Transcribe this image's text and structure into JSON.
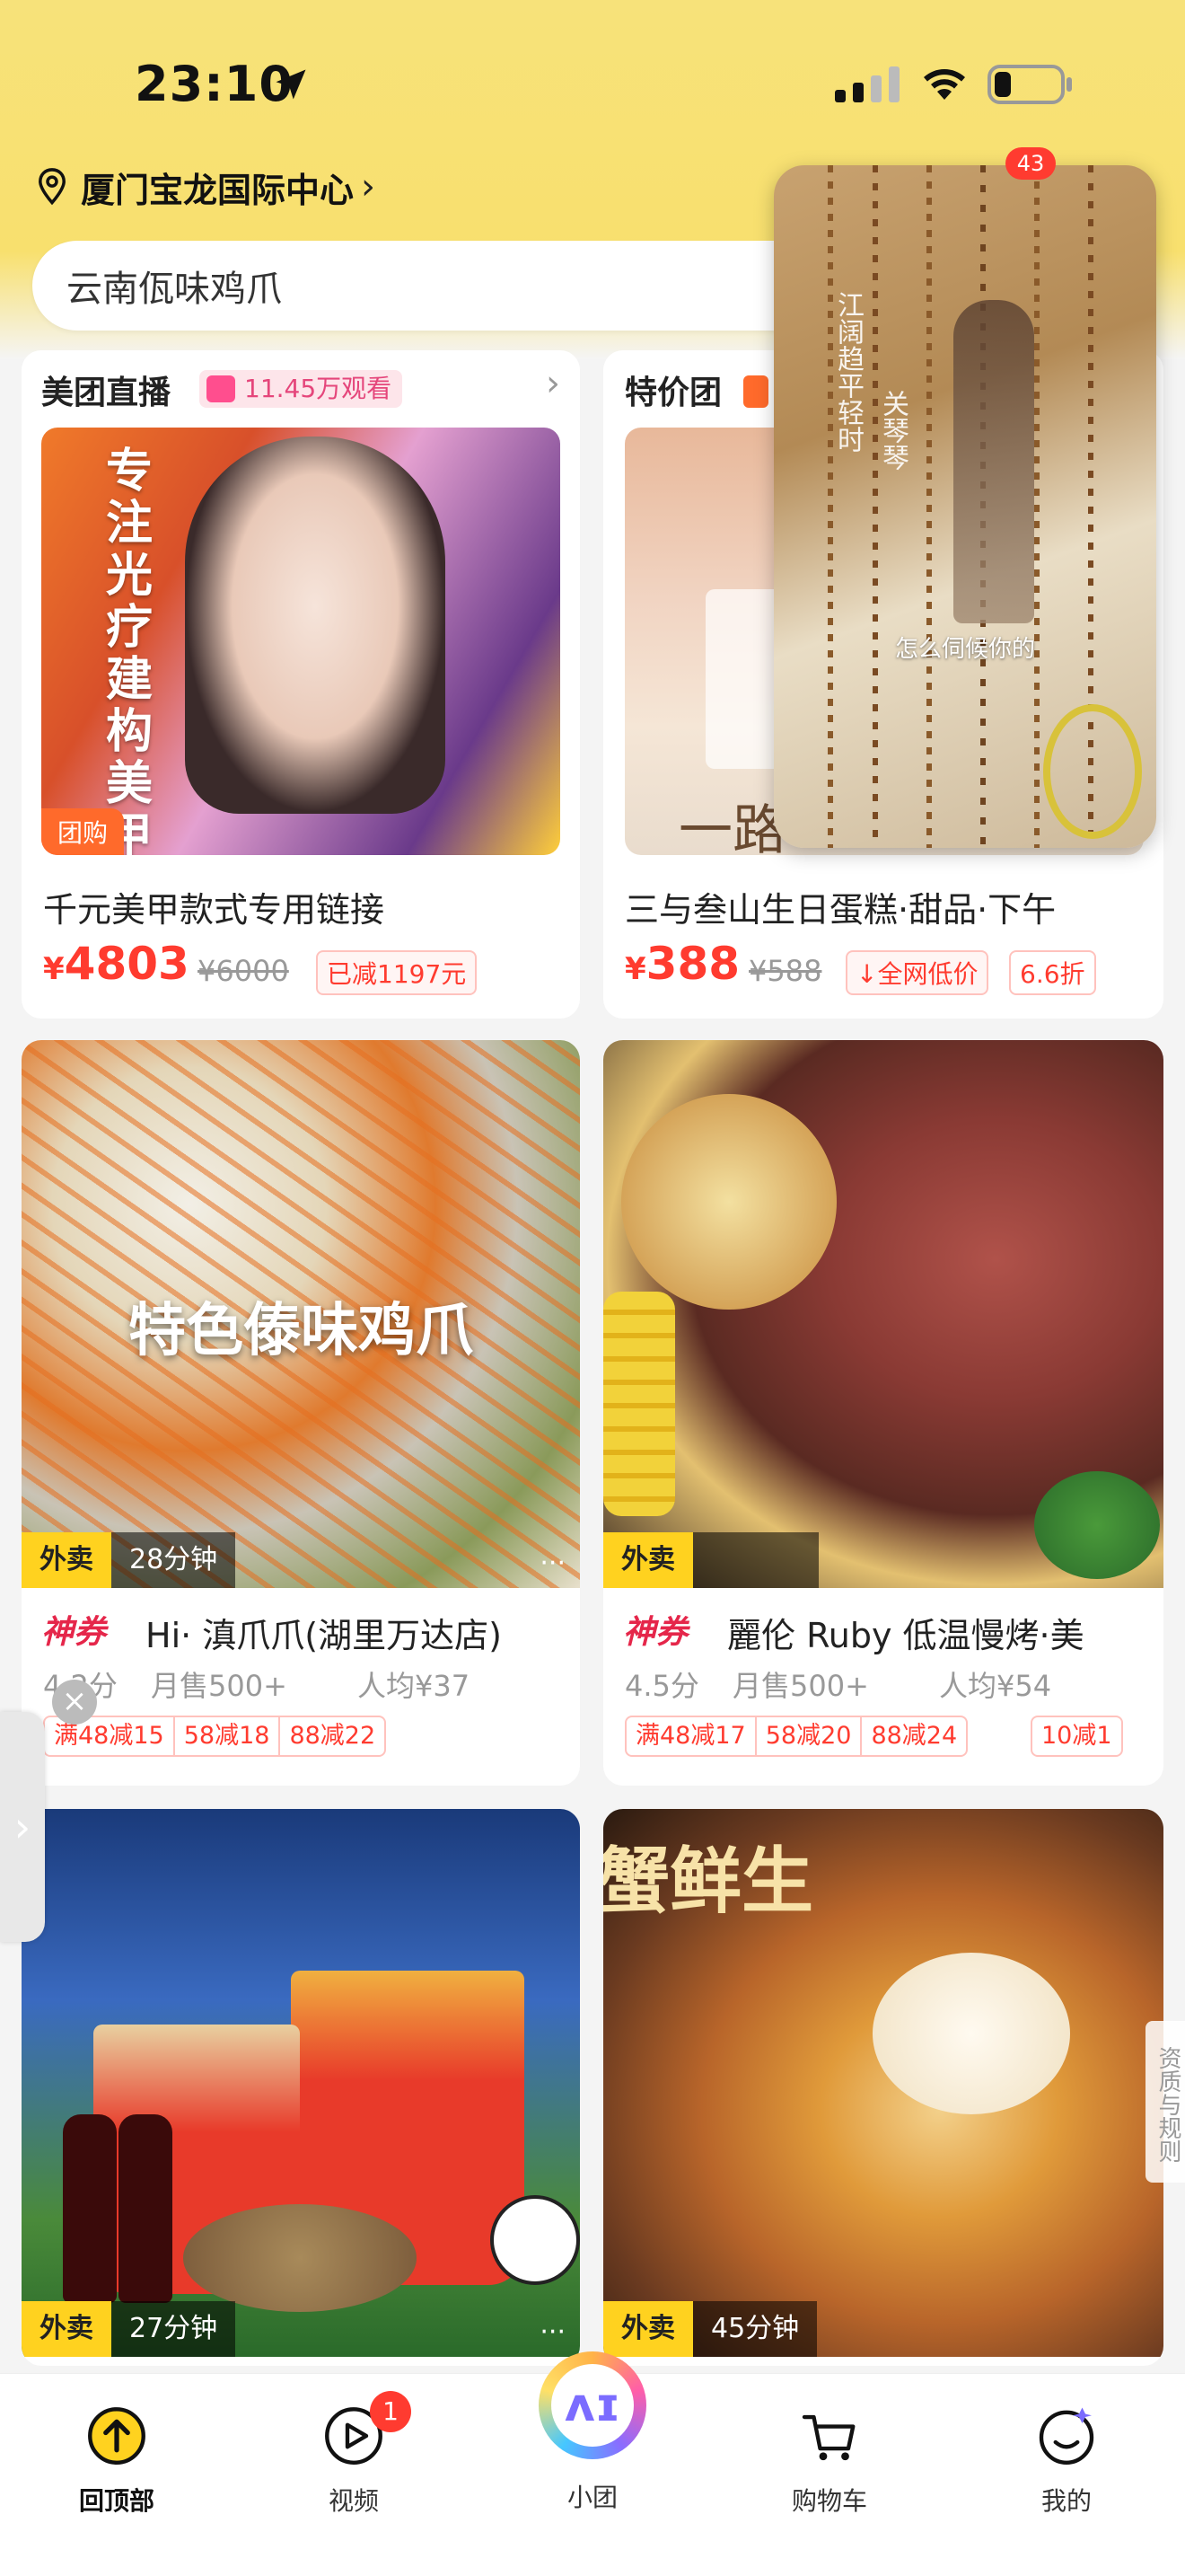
{
  "status_bar": {
    "time": "23:10"
  },
  "location": {
    "text": "厦门宝龙国际中心",
    "chevron": "›"
  },
  "search": {
    "value": "云南佤味鸡爪"
  },
  "float_video": {
    "vertical_text_1": "江阔趋平轻时",
    "vertical_text_2": "关琴琴",
    "caption": "怎么伺候你的",
    "badge": "43"
  },
  "cards": [
    {
      "header": "美团直播",
      "live_viewers": "11.45万观看",
      "header_chevron": "›",
      "img_side_text": "专注光疗建构美甲",
      "badge": "团购",
      "title": "千元美甲款式专用链接",
      "price_symbol": "¥",
      "price": "4803",
      "old_price": "¥6000",
      "tag": "已减1197元"
    },
    {
      "header": "特价团",
      "img_overlay_text": "一路",
      "title": "三与叁山生日蛋糕·甜品·下午",
      "price_symbol": "¥",
      "price": "388",
      "old_price": "¥588",
      "tag": "全网低价",
      "tag_arrow": "↓",
      "tag2": "6.6折"
    },
    {
      "img_overlay_text": "特色傣味鸡爪",
      "waimai": "外卖",
      "time": "28分钟",
      "shenjuan": "神券",
      "title": "Hi· 滇爪爪(湖里万达店)",
      "rating": "4.2分",
      "sales": "月售500+",
      "avg": "人均¥37",
      "discounts": [
        "满48减15",
        "58减18",
        "88减22"
      ]
    },
    {
      "waimai": "外卖",
      "time": "",
      "shenjuan": "神券",
      "title": "麗伦 Ruby 低温慢烤·美",
      "rating": "4.5分",
      "sales": "月售500+",
      "avg": "人均¥54",
      "discounts": [
        "满48减17",
        "58减20",
        "88减24"
      ],
      "extra_discount": "10减1"
    },
    {
      "waimai": "外卖",
      "time": "27分钟"
    },
    {
      "img_overlay_text": "蟹鲜生",
      "waimai": "外卖",
      "time": "45分钟"
    }
  ],
  "side": {
    "qualification": "资质与规则",
    "close": "×",
    "expand": "›"
  },
  "nav": {
    "items": [
      {
        "label": "回顶部",
        "icon": "arrow-up-circle-icon"
      },
      {
        "label": "视频",
        "icon": "play-icon",
        "badge": "1"
      },
      {
        "label": "小团",
        "icon": "xiaotuan-icon"
      },
      {
        "label": "购物车",
        "icon": "cart-icon"
      },
      {
        "label": "我的",
        "icon": "smile-icon"
      }
    ]
  },
  "colors": {
    "brand_yellow": "#f8e06e",
    "price_red": "#ff3b2f",
    "shenjuan_red": "#e5264a",
    "waimai_yellow": "#ffd21f"
  }
}
